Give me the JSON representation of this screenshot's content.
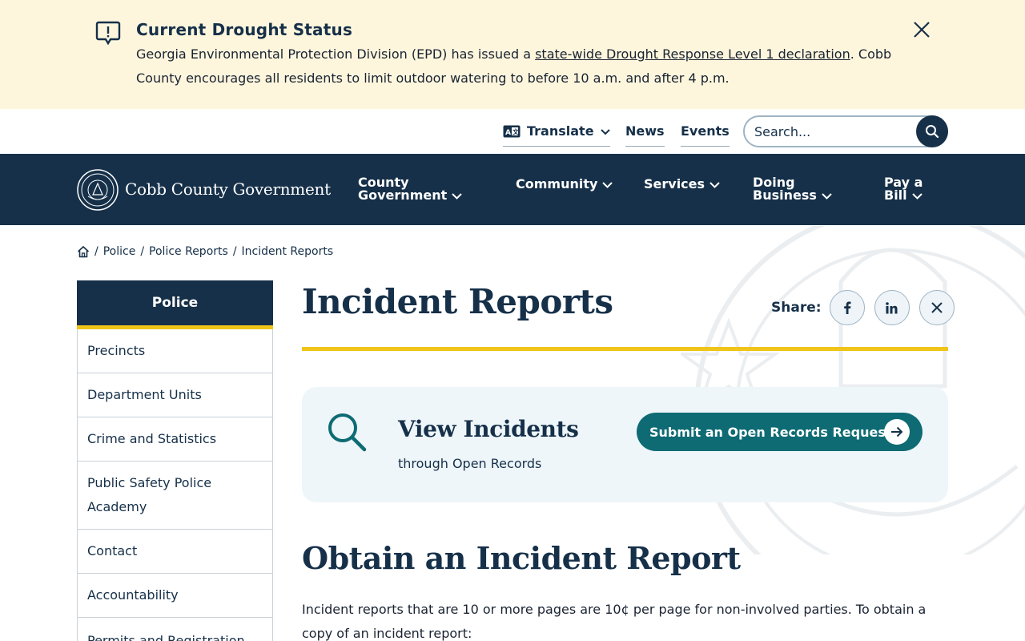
{
  "alert": {
    "title": "Current Drought Status",
    "text_before": "Georgia Environmental Protection Division (EPD) has issued a ",
    "link": "state-wide Drought Response Level 1 declaration",
    "text_after": ". Cobb County encourages all residents to limit outdoor watering to before 10 a.m. and after 4 p.m.",
    "icon": "alert-message-icon",
    "close_icon": "close-icon"
  },
  "utility": {
    "translate_label": "Translate",
    "news_label": "News",
    "events_label": "Events",
    "search_placeholder": "Search...",
    "search_icon": "search-icon"
  },
  "nav": {
    "logo_text": "Cobb County Government",
    "items": [
      {
        "line1": "County",
        "line2": "Government"
      },
      {
        "line1": "Community",
        "line2": ""
      },
      {
        "line1": "Services",
        "line2": ""
      },
      {
        "line1": "Doing",
        "line2": "Business"
      },
      {
        "line1": "Pay a",
        "line2": "Bill"
      }
    ]
  },
  "breadcrumb": {
    "home_icon": "home-icon",
    "items": [
      "Police",
      "Police Reports",
      "Incident Reports"
    ]
  },
  "sidebar": {
    "heading": "Police",
    "items": [
      {
        "label": "Precincts"
      },
      {
        "label": "Department Units"
      },
      {
        "label": "Crime and Statistics"
      },
      {
        "label": "Public Safety Police Academy"
      },
      {
        "label": "Contact"
      },
      {
        "label": "Accountability"
      },
      {
        "label": "Permits and Registration"
      }
    ]
  },
  "page": {
    "title": "Incident Reports",
    "share_label": "Share:",
    "share_icons": [
      "facebook-icon",
      "linkedin-icon",
      "x-icon"
    ]
  },
  "callout": {
    "title": "View Incidents",
    "subtitle": "through Open Records",
    "button_label": "Submit an Open Records Request"
  },
  "section": {
    "heading": "Obtain an Incident Report",
    "body": "Incident reports that are 10 or more pages are 10¢ per page for non-involved parties. To obtain a copy of an incident report:"
  },
  "colors": {
    "navy": "#163049",
    "gold": "#f0c419",
    "teal": "#0e6b73",
    "alert_bg": "#fdf6dd",
    "callout_bg": "#eef6fa"
  }
}
